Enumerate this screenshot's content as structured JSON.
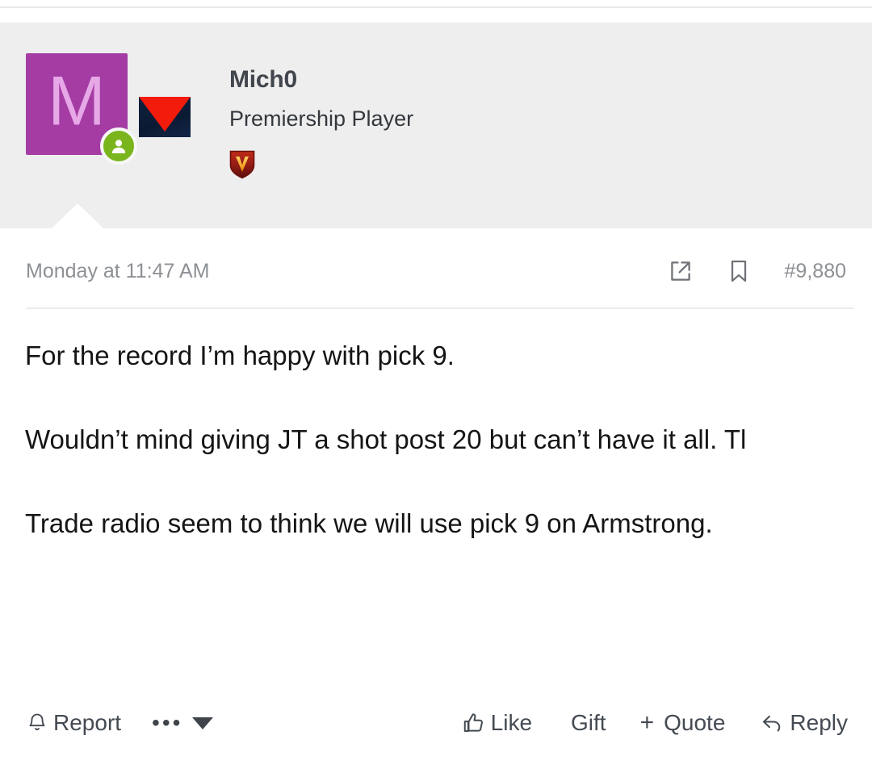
{
  "post": {
    "author": {
      "username": "Mich0",
      "title": "Premiership Player",
      "avatar_letter": "M",
      "avatar_color": "#a43ca4",
      "avatar_letter_color": "#e6a8e6",
      "online_status": "online",
      "online_color": "#7ab51d",
      "team_flag": {
        "name": "team-flag-icon",
        "background_color": "#0e2140",
        "triangle_color": "#f21b0c"
      },
      "badges": [
        {
          "name": "v-shield-badge",
          "letter": "V",
          "shield_color": "#8f1b14",
          "letter_color": "#f5a623"
        }
      ]
    },
    "meta": {
      "timestamp": "Monday at 11:47 AM",
      "post_number": "#9,880",
      "share_icon": "share-icon",
      "bookmark_icon": "bookmark-icon"
    },
    "content": [
      "For the record I’m happy with pick 9.",
      "Wouldn’t mind giving JT a shot post 20 but can’t have it all. Tl",
      "Trade radio seem to think we will use pick 9 on Armstrong."
    ],
    "actions": {
      "report": "Report",
      "more": "•••",
      "like": "Like",
      "gift": "Gift",
      "quote": "Quote",
      "quote_prefix": "+",
      "reply": "Reply"
    }
  },
  "colors": {
    "header_background": "#eeeeee",
    "page_background": "#ffffff",
    "text_primary": "#151515",
    "text_muted": "#8d9094",
    "username": "#41464d",
    "divider": "#ececec"
  }
}
